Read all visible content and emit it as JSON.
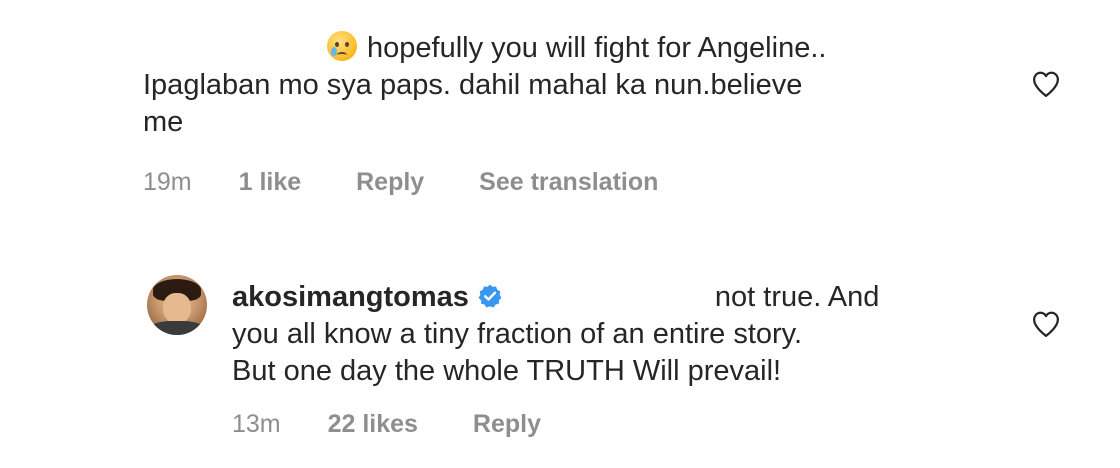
{
  "comments": [
    {
      "lines": [
        "hopefully you will fight for Angeline..",
        "Ipaglaban mo sya paps. dahil mahal ka nun.believe",
        "me"
      ],
      "emoji": "crying-face-icon",
      "meta": {
        "time": "19m",
        "likes": "1 like",
        "reply": "Reply",
        "translation": "See translation"
      }
    },
    {
      "username": "akosimangtomas",
      "verified": true,
      "lines": [
        "not true. And",
        "you all know a tiny fraction of an entire story.",
        "But one day the whole TRUTH Will prevail!"
      ],
      "meta": {
        "time": "13m",
        "likes": "22 likes",
        "reply": "Reply"
      }
    }
  ],
  "colors": {
    "text": "#262626",
    "meta": "#8e8e8e",
    "verified": "#3897f0",
    "heart_outline": "#262626"
  }
}
